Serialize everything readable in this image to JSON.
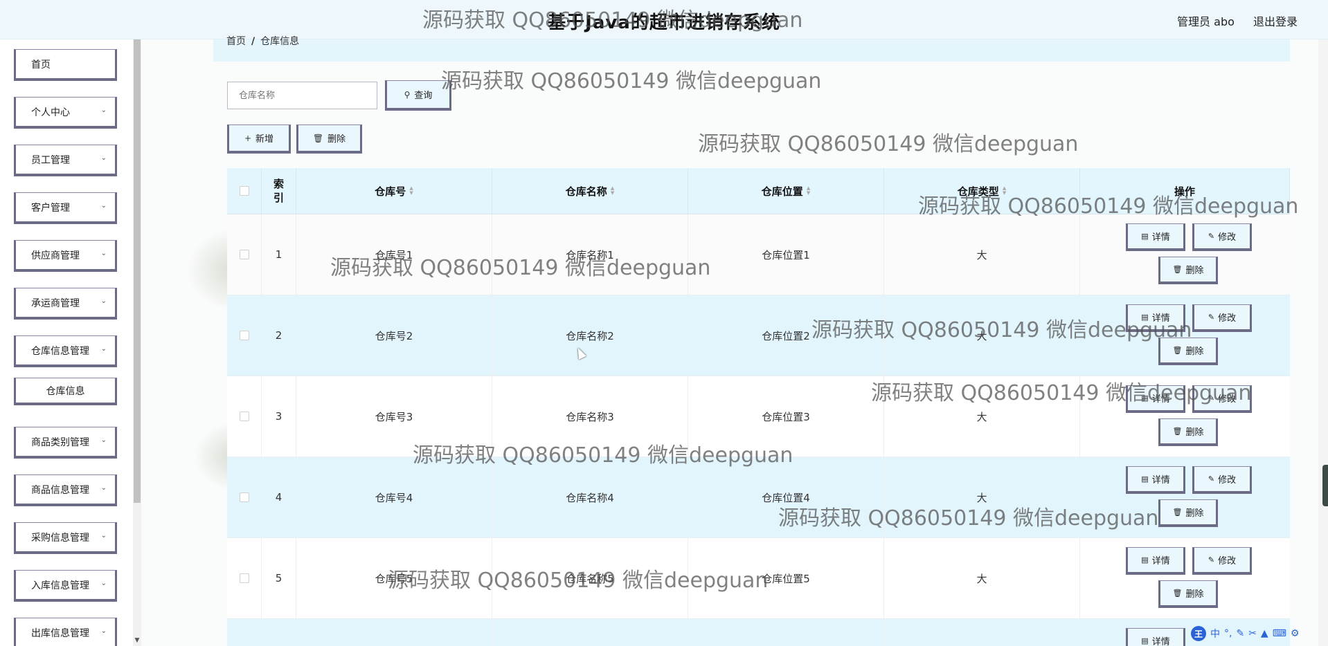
{
  "header": {
    "title": "基于Java的超市进销存系统",
    "user_label": "管理员 abo",
    "logout_label": "退出登录"
  },
  "sidebar": {
    "items": [
      {
        "label": "首页",
        "expandable": false
      },
      {
        "label": "个人中心",
        "expandable": true
      },
      {
        "label": "员工管理",
        "expandable": true
      },
      {
        "label": "客户管理",
        "expandable": true
      },
      {
        "label": "供应商管理",
        "expandable": true
      },
      {
        "label": "承运商管理",
        "expandable": true
      },
      {
        "label": "仓库信息管理",
        "expandable": true
      },
      {
        "label": "仓库信息",
        "expandable": false,
        "submenu": true
      },
      {
        "label": "商品类别管理",
        "expandable": true
      },
      {
        "label": "商品信息管理",
        "expandable": true
      },
      {
        "label": "采购信息管理",
        "expandable": true
      },
      {
        "label": "入库信息管理",
        "expandable": true
      },
      {
        "label": "出库信息管理",
        "expandable": true
      }
    ]
  },
  "breadcrumb": {
    "home": "首页",
    "separator": "/",
    "current": "仓库信息"
  },
  "search": {
    "placeholder": "仓库名称",
    "button_label": "查询"
  },
  "toolbar": {
    "add_label": "新增",
    "delete_label": "删除"
  },
  "table": {
    "headers": {
      "index": "索引",
      "warehouse_no": "仓库号",
      "warehouse_name": "仓库名称",
      "warehouse_location": "仓库位置",
      "warehouse_type": "仓库类型",
      "actions": "操作"
    },
    "action_labels": {
      "detail": "详情",
      "edit": "修改",
      "delete": "删除"
    },
    "rows": [
      {
        "index": "1",
        "no": "仓库号1",
        "name": "仓库名称1",
        "location": "仓库位置1",
        "type": "大"
      },
      {
        "index": "2",
        "no": "仓库号2",
        "name": "仓库名称2",
        "location": "仓库位置2",
        "type": "大"
      },
      {
        "index": "3",
        "no": "仓库号3",
        "name": "仓库名称3",
        "location": "仓库位置3",
        "type": "大"
      },
      {
        "index": "4",
        "no": "仓库号4",
        "name": "仓库名称4",
        "location": "仓库位置4",
        "type": "大"
      },
      {
        "index": "5",
        "no": "仓库号5",
        "name": "仓库名称5",
        "location": "仓库位置5",
        "type": "大"
      }
    ],
    "partial_row_action": "详情"
  },
  "watermark": "源码获取 QQ86050149 微信deepguan",
  "ime": {
    "logo": "王",
    "mode": "中"
  },
  "colors": {
    "header_bg": "#eef7fb",
    "table_header_bg": "#e3f6fd",
    "stripe_bg": "#e3f5fc",
    "button_border": "#6b6b85"
  }
}
